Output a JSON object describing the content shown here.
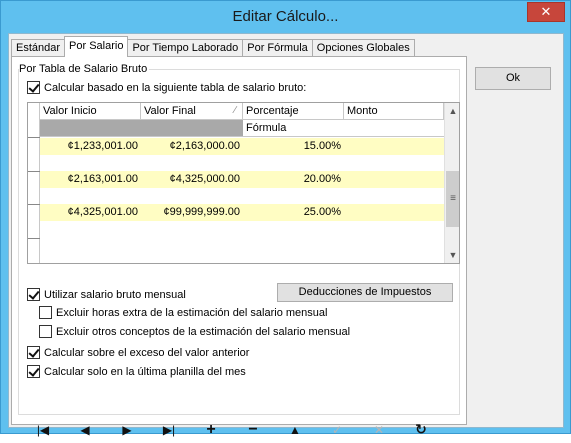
{
  "window": {
    "title": "Editar Cálculo...",
    "close_glyph": "✕"
  },
  "tabs": [
    {
      "label": "Estándar",
      "active": false
    },
    {
      "label": "Por Salario",
      "active": true
    },
    {
      "label": "Por Tiempo Laborado",
      "active": false
    },
    {
      "label": "Por Fórmula",
      "active": false
    },
    {
      "label": "Opciones Globales",
      "active": false
    }
  ],
  "ok_label": "Ok",
  "group_label": "Por Tabla de Salario Bruto",
  "calc_table_checkbox": {
    "label": "Calcular basado en la siguiente tabla de salario bruto:",
    "checked": true
  },
  "grid": {
    "headers": [
      "Valor Inicio",
      "Valor Final",
      "Porcentaje",
      "Monto"
    ],
    "formula_label": "Fórmula",
    "rows": [
      {
        "start": "¢1,233,001.00",
        "end": "¢2,163,000.00",
        "percent": "15.00%",
        "amount": ""
      },
      {
        "start": "¢2,163,001.00",
        "end": "¢4,325,000.00",
        "percent": "20.00%",
        "amount": ""
      },
      {
        "start": "¢4,325,001.00",
        "end": "¢99,999,999.00",
        "percent": "25.00%",
        "amount": ""
      }
    ],
    "row_highlight_color": "#fffdc3"
  },
  "options": {
    "monthly_gross": {
      "label": "Utilizar salario bruto mensual",
      "checked": true
    },
    "exclude_overtime": {
      "label": "Excluir horas extra de la estimación del salario mensual",
      "checked": false
    },
    "exclude_other": {
      "label": "Excluir otros conceptos de la estimación del salario mensual",
      "checked": false
    },
    "excess_previous": {
      "label": "Calcular sobre el exceso del valor anterior",
      "checked": true
    },
    "last_payroll": {
      "label": "Calcular solo en la última planilla del mes",
      "checked": true
    }
  },
  "deductions_button": "Deducciones de Impuestos",
  "navigator": [
    {
      "name": "first-icon",
      "glyph": "|◀",
      "enabled": true
    },
    {
      "name": "prior-icon",
      "glyph": "◀",
      "enabled": true
    },
    {
      "name": "next-icon",
      "glyph": "▶",
      "enabled": true
    },
    {
      "name": "last-icon",
      "glyph": "▶|",
      "enabled": true
    },
    {
      "name": "insert-icon",
      "glyph": "+",
      "enabled": true
    },
    {
      "name": "delete-icon",
      "glyph": "−",
      "enabled": true
    },
    {
      "name": "edit-icon",
      "glyph": "▲",
      "enabled": true
    },
    {
      "name": "post-icon",
      "glyph": "✓",
      "enabled": false
    },
    {
      "name": "cancel-icon",
      "glyph": "✕",
      "enabled": false
    },
    {
      "name": "refresh-icon",
      "glyph": "↻",
      "enabled": true
    }
  ]
}
